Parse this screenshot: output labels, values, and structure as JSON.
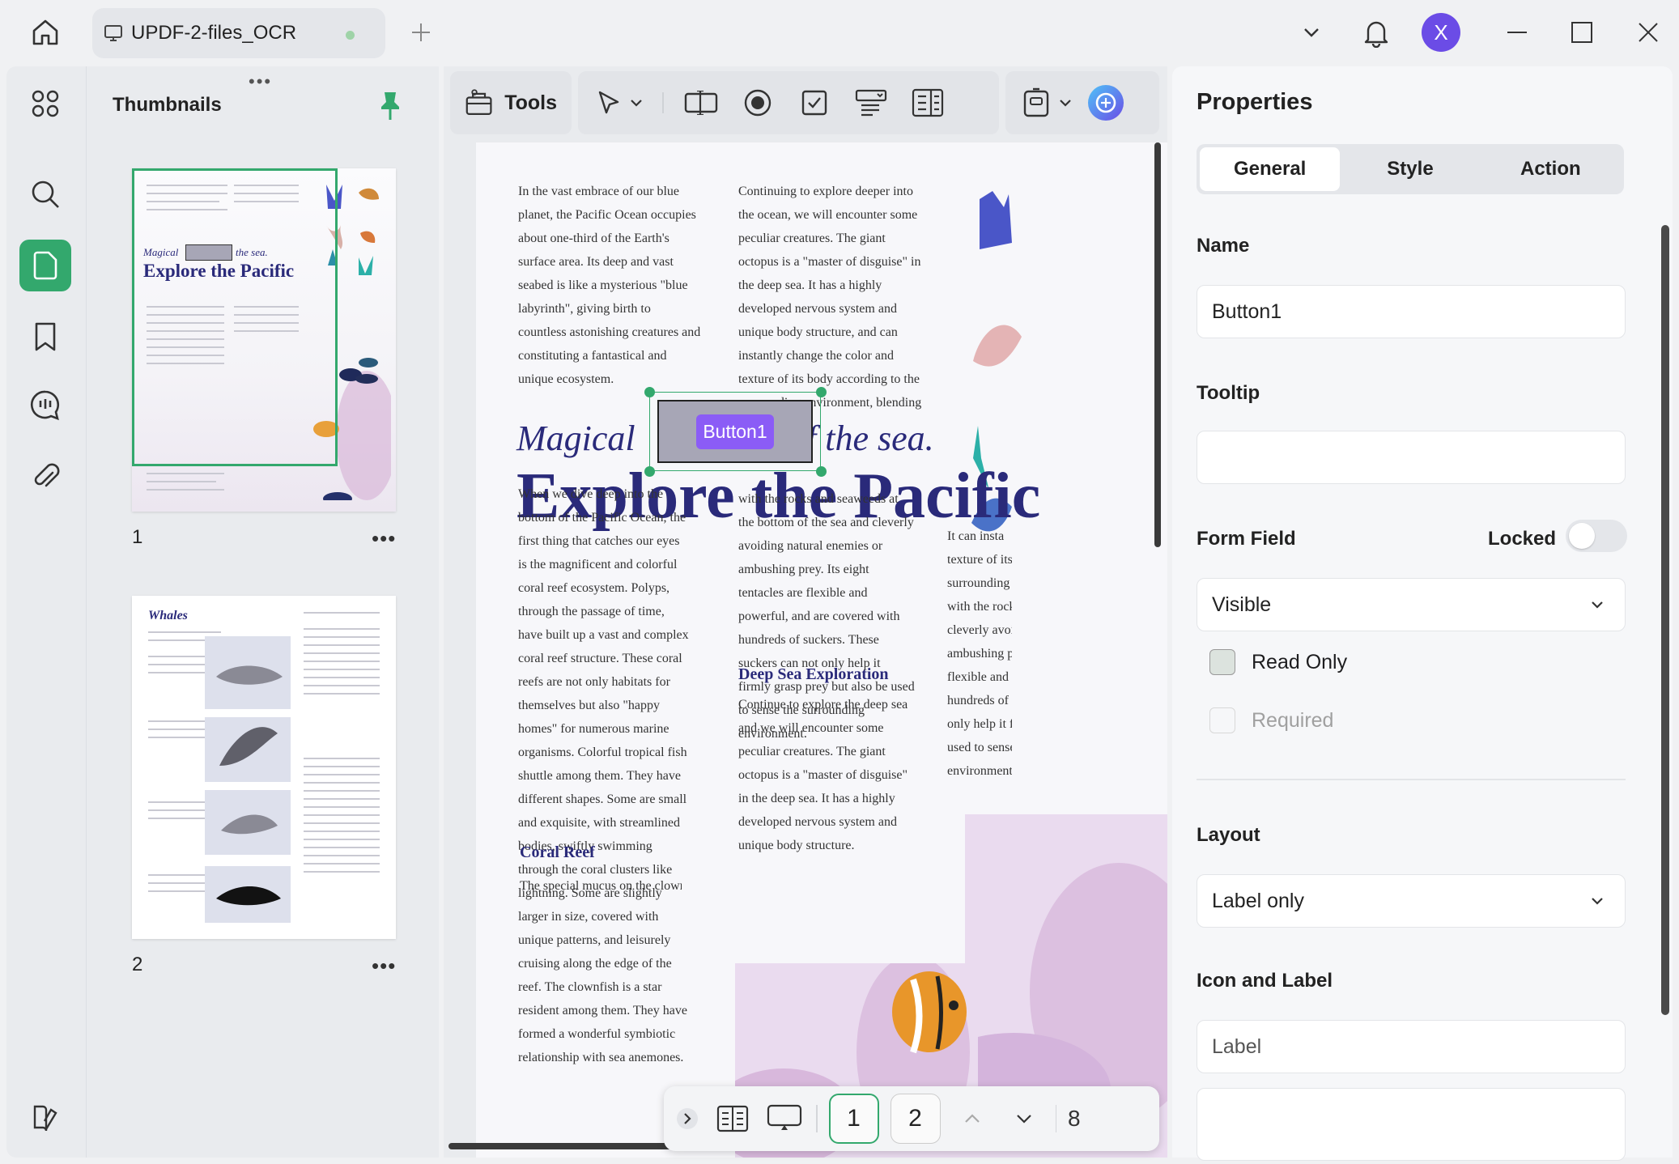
{
  "titlebar": {
    "tab_title": "UPDF-2-files_OCR",
    "avatar_letter": "X",
    "accent": "#33a86d",
    "avatar_color": "#6b4ce6"
  },
  "thumbnails": {
    "title": "Thumbnails",
    "handle": "•••",
    "more": "•••",
    "pages": [
      {
        "number": "1",
        "mini_magical": "Magical",
        "mini_ofsea": "the sea.",
        "mini_title": "Explore the Pacific"
      },
      {
        "number": "2",
        "mini_title": "Whales"
      }
    ]
  },
  "toolbar": {
    "tools_label": "Tools"
  },
  "document": {
    "col1_top": "In the vast embrace of our blue planet, the Pacific Ocean occupies about one-third of the Earth's surface area. Its deep and vast seabed is like a mysterious \"blue labyrinth\", giving birth to countless astonishing creatures and constituting a fantastical and unique ecosystem.",
    "col2_top": "Continuing to explore deeper into the ocean, we will encounter some peculiar creatures. The giant octopus is a \"master of disguise\" in the deep sea. It has a highly developed nervous system and unique body structure, and can instantly change the color and texture of its body according to the surrounding environment, blending in",
    "magical": "Magical",
    "of_the_sea": "f the sea.",
    "title": "Explore the Pacific",
    "button_field_label": "Button1",
    "col1_body": "When we dive deep into the bottom of the Pacific Ocean, the first thing that catches our eyes is the magnificent and colorful coral reef ecosystem. Polyps, through the passage of time, have built up a vast and complex coral reef structure. These coral reefs are not only habitats for themselves but also \"happy homes\" for numerous marine organisms. Colorful tropical fish shuttle among them. They have different shapes. Some are small and exquisite, with streamlined bodies, swiftly swimming through the coral clusters like lightning. Some are slightly larger in size, covered with unique patterns, and leisurely cruising along the edge of the reef. The clownfish is a star resident among them. They have formed a wonderful symbiotic relationship with sea anemones.",
    "coral_reef_heading": "Coral Reef",
    "coral_reef_text": "The special mucus on the clownfish makes them im",
    "col2_body": "with the rocks and seaweeds at the bottom of the sea and cleverly avoiding natural enemies or ambushing prey. Its eight tentacles are flexible and powerful, and are covered with hundreds of suckers. These suckers can not only help it firmly grasp prey but also be used to sense the surrounding environment.",
    "deep_sea_heading": "Deep Sea Exploration",
    "deep_sea_text": "Continue to explore the deep sea and we will encounter some peculiar creatures. The giant octopus is a \"master of disguise\" in the deep sea. It has a highly developed nervous system and unique body structure.",
    "col3_lines": [
      "It can insta",
      "texture of its",
      "surrounding",
      "with the rock",
      "cleverly avoi",
      "ambushing p",
      "flexible and p",
      "hundreds of s",
      "only help it f",
      "used to sense",
      "environment"
    ]
  },
  "pager": {
    "page_current": "1",
    "page_next": "2",
    "zoom_partial": "8"
  },
  "properties": {
    "title": "Properties",
    "tabs": [
      "General",
      "Style",
      "Action"
    ],
    "name_label": "Name",
    "name_value": "Button1",
    "tooltip_label": "Tooltip",
    "tooltip_value": "",
    "form_field_label": "Form Field",
    "locked_label": "Locked",
    "visibility_value": "Visible",
    "read_only_label": "Read Only",
    "required_label": "Required",
    "layout_label": "Layout",
    "layout_value": "Label only",
    "icon_label_heading": "Icon and Label",
    "label_placeholder": "Label"
  }
}
